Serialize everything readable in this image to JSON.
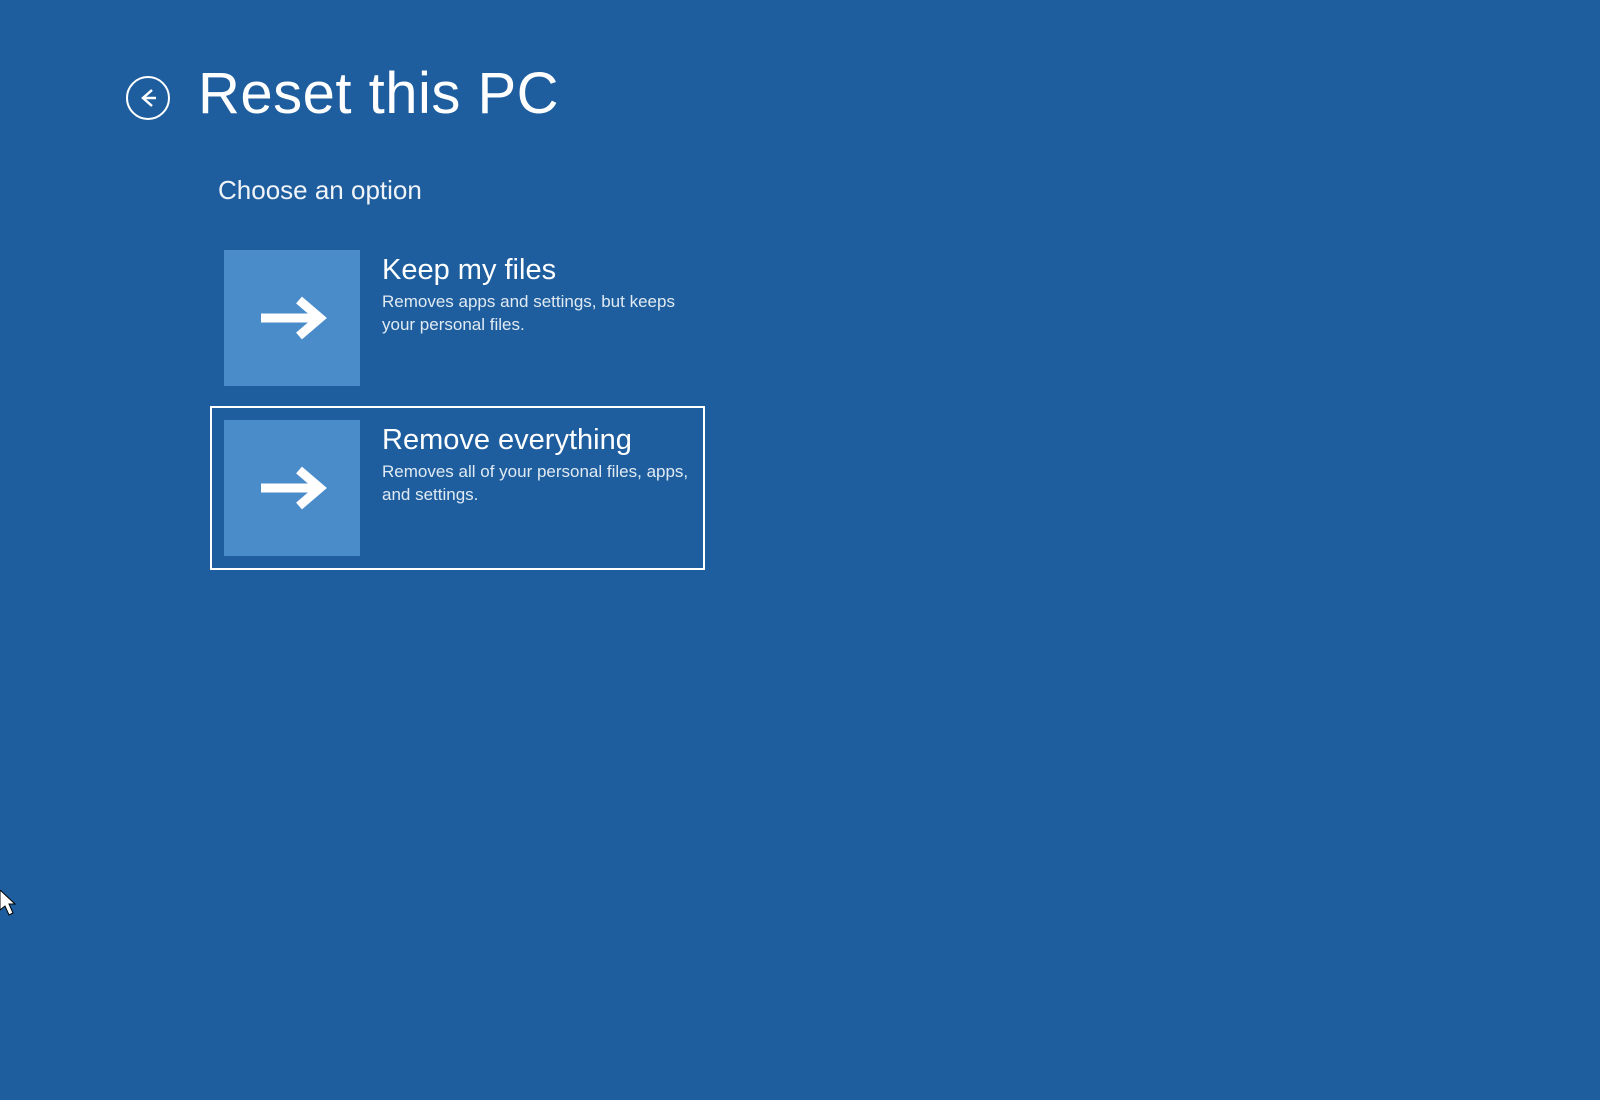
{
  "header": {
    "title": "Reset this PC"
  },
  "subtitle": "Choose an option",
  "options": [
    {
      "title": "Keep my files",
      "description": "Removes apps and settings, but keeps your personal files.",
      "selected": false
    },
    {
      "title": "Remove everything",
      "description": "Removes all of your personal files, apps, and settings.",
      "selected": true
    }
  ]
}
